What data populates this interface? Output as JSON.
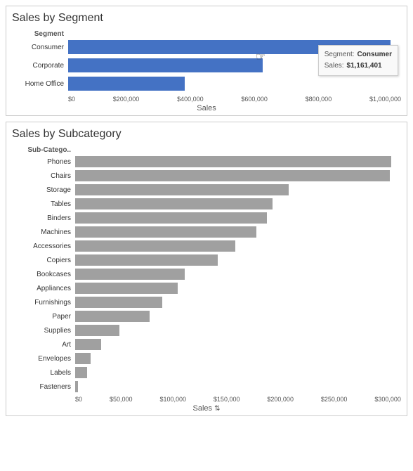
{
  "salesBySegment": {
    "title": "Sales by Segment",
    "yAxisLabel": "Segment",
    "xAxisLabel": "Sales",
    "xAxisTicks": [
      "$0",
      "$200,000",
      "$400,000",
      "$600,000",
      "$800,000",
      "$1,000,000"
    ],
    "bars": [
      {
        "label": "Consumer",
        "value": 1161401,
        "maxValue": 1200000,
        "color": "blue"
      },
      {
        "label": "Corporate",
        "value": 700000,
        "maxValue": 1200000,
        "color": "blue"
      },
      {
        "label": "Home Office",
        "value": 420000,
        "maxValue": 1200000,
        "color": "blue"
      }
    ],
    "tooltip": {
      "segment": "Consumer",
      "salesLabel": "Sales:",
      "salesValue": "$1,161,401"
    }
  },
  "salesBySubcategory": {
    "title": "Sales by Subcategory",
    "yAxisLabel": "Sub-Catego..",
    "xAxisLabel": "Sales",
    "xAxisTicks": [
      "$0",
      "$50,000",
      "$100,000",
      "$150,000",
      "$200,000",
      "$250,000",
      "$300,000"
    ],
    "bars": [
      {
        "label": "Phones",
        "value": 330000,
        "maxValue": 340000
      },
      {
        "label": "Chairs",
        "value": 328000,
        "maxValue": 340000
      },
      {
        "label": "Storage",
        "value": 223000,
        "maxValue": 340000
      },
      {
        "label": "Tables",
        "value": 206000,
        "maxValue": 340000
      },
      {
        "label": "Binders",
        "value": 200000,
        "maxValue": 340000
      },
      {
        "label": "Machines",
        "value": 189000,
        "maxValue": 340000
      },
      {
        "label": "Accessories",
        "value": 167000,
        "maxValue": 340000
      },
      {
        "label": "Copiers",
        "value": 149000,
        "maxValue": 340000
      },
      {
        "label": "Bookcases",
        "value": 114000,
        "maxValue": 340000
      },
      {
        "label": "Appliances",
        "value": 107000,
        "maxValue": 340000
      },
      {
        "label": "Furnishings",
        "value": 91000,
        "maxValue": 340000
      },
      {
        "label": "Paper",
        "value": 78000,
        "maxValue": 340000
      },
      {
        "label": "Supplies",
        "value": 46000,
        "maxValue": 340000
      },
      {
        "label": "Art",
        "value": 27000,
        "maxValue": 340000
      },
      {
        "label": "Envelopes",
        "value": 16000,
        "maxValue": 340000
      },
      {
        "label": "Labels",
        "value": 12500,
        "maxValue": 340000
      },
      {
        "label": "Fasteners",
        "value": 3000,
        "maxValue": 340000
      }
    ]
  }
}
